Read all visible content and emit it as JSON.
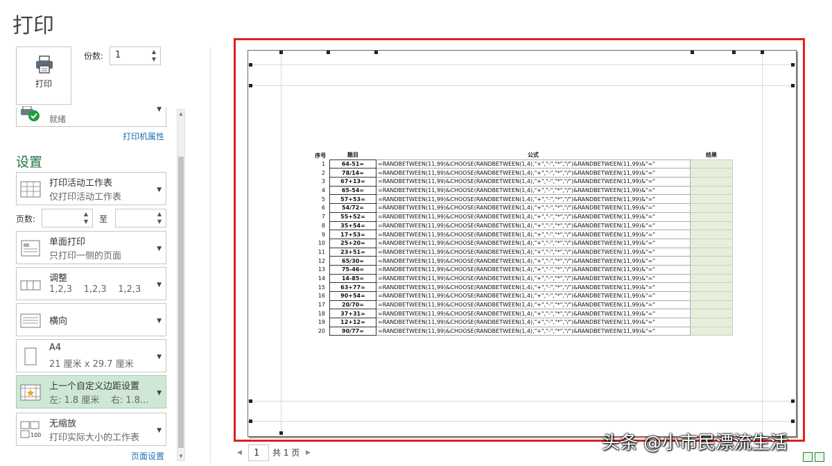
{
  "title": "打印",
  "print_button": {
    "label": "打印",
    "icon": "printer-icon"
  },
  "copies": {
    "label": "份数:",
    "value": "1"
  },
  "printer": {
    "status": "就绪",
    "properties_link": "打印机属性"
  },
  "settings": {
    "heading": "设置",
    "active_sheet": {
      "title": "打印活动工作表",
      "subtitle": "仅打印活动工作表"
    },
    "pages": {
      "label": "页数:",
      "to": "至",
      "from_value": "",
      "to_value": ""
    },
    "sided": {
      "title": "单面打印",
      "subtitle": "只打印一侧的页面"
    },
    "collate": {
      "title": "调整",
      "subtitle": "1,2,3    1,2,3    1,2,3"
    },
    "orientation": {
      "title": "横向"
    },
    "paper": {
      "title": "A4",
      "subtitle": "21 厘米 x 29.7 厘米"
    },
    "margins": {
      "title": "上一个自定义边距设置",
      "subtitle": "左: 1.8 厘米    右: 1.8..."
    },
    "scaling": {
      "title": "无缩放",
      "subtitle": "打印实际大小的工作表"
    },
    "page_setup_link": "页面设置"
  },
  "pager": {
    "current": "1",
    "total": "共 1 页"
  },
  "watermark": "头条 @小市民漂流生活",
  "colors": {
    "accent": "#217346",
    "highlight": "#e02020",
    "selected": "#cfe8d5",
    "result_fill": "#e8eedc"
  },
  "preview_table": {
    "headers": [
      "序号",
      "题目",
      "公式",
      "结果"
    ],
    "formula": "=RANDBETWEEN(11,99)&CHOOSE(RANDBETWEEN(1,4),\"+\",\"-\",\"*\",\"/\")&RANDBETWEEN(11,99)&\"=\"",
    "rows": [
      [
        "1",
        "64-51="
      ],
      [
        "2",
        "78/14="
      ],
      [
        "3",
        "67+13="
      ],
      [
        "4",
        "65-54="
      ],
      [
        "5",
        "57+53="
      ],
      [
        "6",
        "54/72="
      ],
      [
        "7",
        "55+52="
      ],
      [
        "8",
        "35+54="
      ],
      [
        "9",
        "17+53="
      ],
      [
        "10",
        "25+20="
      ],
      [
        "11",
        "23+51="
      ],
      [
        "12",
        "65/30="
      ],
      [
        "13",
        "75-46="
      ],
      [
        "14",
        "14-85="
      ],
      [
        "15",
        "63+77="
      ],
      [
        "16",
        "90+54="
      ],
      [
        "17",
        "20/70="
      ],
      [
        "18",
        "37+31="
      ],
      [
        "19",
        "12+12="
      ],
      [
        "20",
        "90/77="
      ]
    ]
  }
}
